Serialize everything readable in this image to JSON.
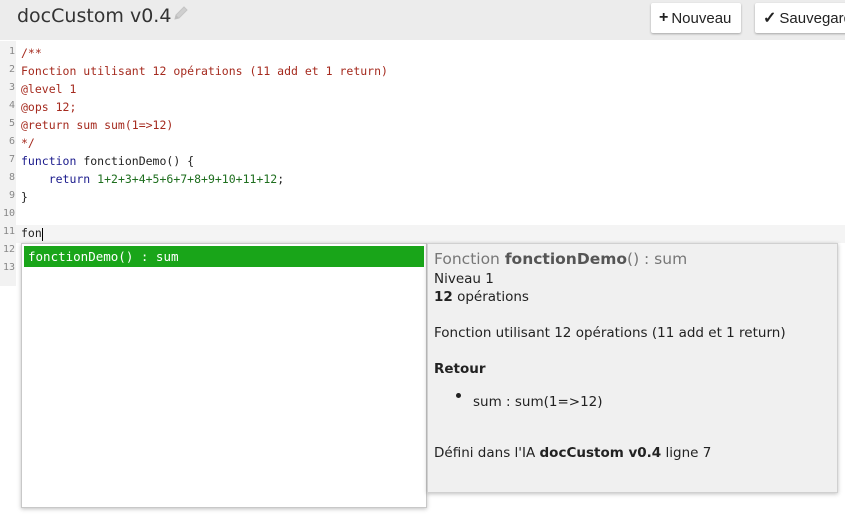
{
  "header": {
    "title": "docCustom v0.4",
    "new_label": "Nouveau",
    "save_label": "Sauvegarder"
  },
  "editor": {
    "lines": [
      {
        "no": "1",
        "text": "/**"
      },
      {
        "no": "2",
        "text": "Fonction utilisant 12 opérations (11 add et 1 return)"
      },
      {
        "no": "3",
        "text": "@level 1"
      },
      {
        "no": "4",
        "text": "@ops 12;"
      },
      {
        "no": "5",
        "text": "@return sum sum(1=>12)"
      },
      {
        "no": "6",
        "text": "*/"
      },
      {
        "no": "7",
        "text_kw": "function",
        "text_rest": " fonctionDemo() {"
      },
      {
        "no": "8",
        "text_kw": "    return",
        "text_num": " 1+2+3+4+5+6+7+8+9+10+11+12",
        "text_end": ";"
      },
      {
        "no": "9",
        "text": "}"
      },
      {
        "no": "10",
        "text": ""
      },
      {
        "no": "11",
        "text": "fon"
      },
      {
        "no": "12",
        "text": ""
      },
      {
        "no": "13",
        "text": ""
      }
    ]
  },
  "autocomplete": {
    "selected_item": "fonctionDemo() : sum"
  },
  "doc": {
    "title_prefix": "Fonction ",
    "title_name": "fonctionDemo",
    "title_suffix": "() : sum",
    "level": "Niveau 1",
    "ops_count": "12",
    "ops_label": " opérations",
    "description": "Fonction utilisant 12 opérations (11 add et 1 return)",
    "return_heading": "Retour",
    "return_item": "sum : sum(1=>12)",
    "defined_prefix": "Défini dans l'IA ",
    "defined_ai": "docCustom v0.4",
    "defined_suffix": " ligne 7"
  },
  "colors": {
    "accent": "#19a519",
    "comment": "#a52a1e",
    "keyword": "#1a1a8c",
    "number": "#1e6e1e"
  }
}
